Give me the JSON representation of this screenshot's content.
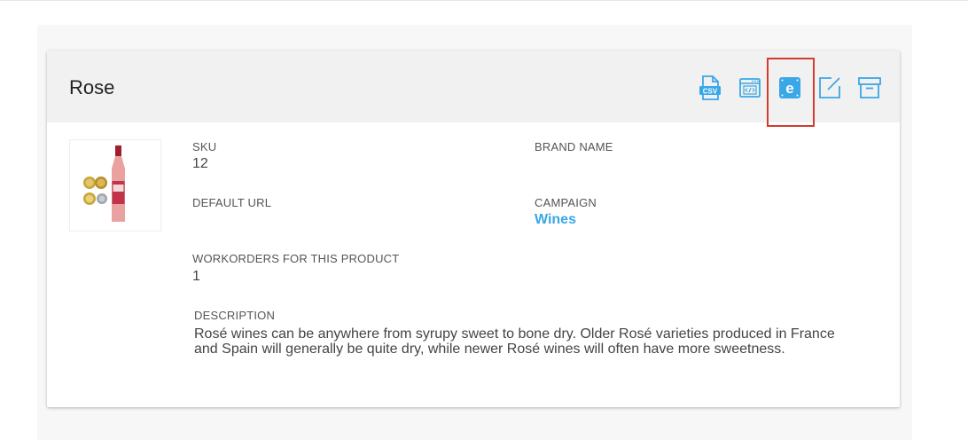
{
  "product": {
    "title": "Rose",
    "image_alt": "Rose wine bottle with medals",
    "fields": {
      "sku_label": "SKU",
      "sku_value": "12",
      "brand_label": "BRAND NAME",
      "brand_value": "",
      "url_label": "DEFAULT URL",
      "url_value": "",
      "campaign_label": "CAMPAIGN",
      "campaign_value": "Wines",
      "workorders_label": "WORKORDERS FOR THIS PRODUCT",
      "workorders_value": "1",
      "description_label": "DESCRIPTION",
      "description_value": "Rosé wines can be anywhere from syrupy sweet to bone dry. Older Rosé varieties produced in France and Spain will generally be quite dry, while newer Rosé wines will often have more sweetness."
    }
  },
  "actions": [
    {
      "icon": "csv-file-icon"
    },
    {
      "icon": "code-window-icon"
    },
    {
      "icon": "e-badge-icon",
      "highlighted": true
    },
    {
      "icon": "edit-icon"
    },
    {
      "icon": "archive-icon"
    }
  ],
  "colors": {
    "accent": "#3aa7e6",
    "header_bg": "#f1f1f1",
    "highlight_border": "#d23b2e"
  }
}
